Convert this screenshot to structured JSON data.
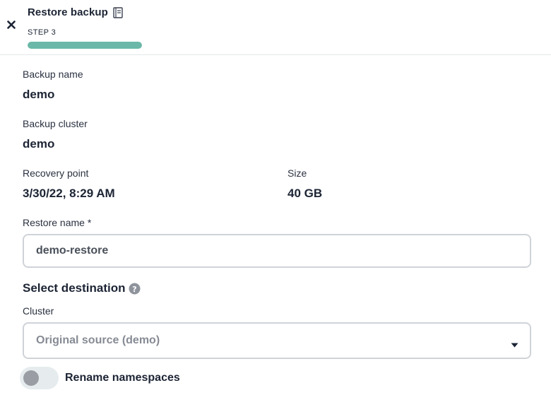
{
  "header": {
    "title": "Restore backup",
    "step_label": "STEP 3",
    "progress_fraction": 1.0,
    "close_icon": "close-icon",
    "doc_icon": "document-icon"
  },
  "fields": {
    "backup_name_label": "Backup name",
    "backup_name_value": "demo",
    "backup_cluster_label": "Backup cluster",
    "backup_cluster_value": "demo",
    "recovery_point_label": "Recovery point",
    "recovery_point_value": "3/30/22, 8:29 AM",
    "size_label": "Size",
    "size_value": "40 GB",
    "restore_name_label": "Restore name *",
    "restore_name_value": "demo-restore"
  },
  "destination": {
    "section_title": "Select destination",
    "help_icon": "help-icon",
    "cluster_label": "Cluster",
    "cluster_selected": "Original source (demo)"
  },
  "toggle": {
    "label": "Rename namespaces",
    "on": false
  },
  "colors": {
    "accent": "#6bb8a8",
    "text": "#1c2434",
    "border": "#cfd3d8"
  }
}
